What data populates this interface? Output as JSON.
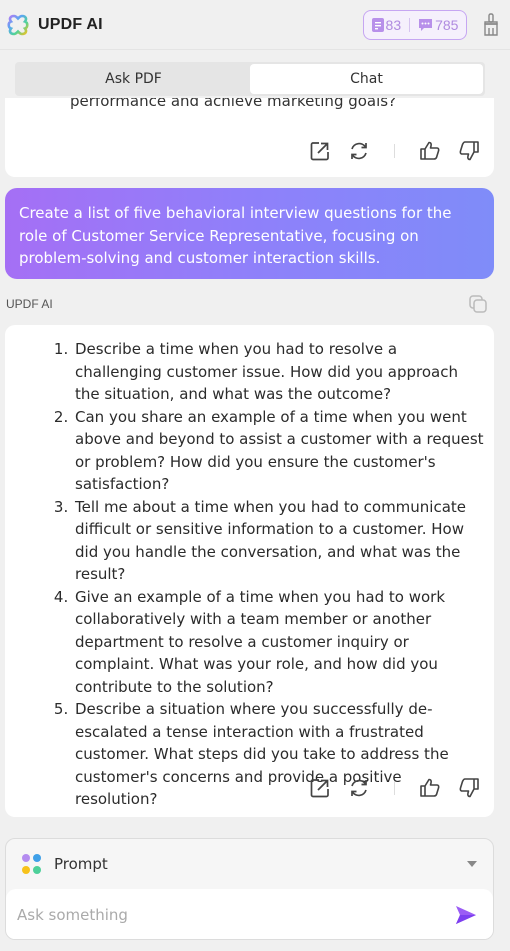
{
  "header": {
    "app_title": "UPDF AI",
    "doc_quota": "83",
    "chat_quota": "785"
  },
  "tabs": [
    {
      "label": "Ask PDF",
      "active": false
    },
    {
      "label": "Chat",
      "active": true
    }
  ],
  "previous_answer": {
    "tail_text": "performance and achieve marketing goals?"
  },
  "user_message": "Create a list of five behavioral interview questions for the role of Customer Service Representative, focusing on problem-solving and customer interaction skills.",
  "ai_label": "UPDF AI",
  "answer": {
    "items": [
      "Describe a time when you had to resolve a challenging customer issue. How did you approach the situation, and what was the outcome?",
      "Can you share an example of a time when you went above and beyond to assist a customer with a request or problem? How did you ensure the customer's satisfaction?",
      "Tell me about a time when you had to communicate difficult or sensitive information to a customer. How did you handle the conversation, and what was the result?",
      "Give an example of a time when you had to work collaboratively with a team member or another department to resolve a customer inquiry or complaint. What was your role, and how did you contribute to the solution?",
      "Describe a situation where you successfully de-escalated a tense interaction with a frustrated customer. What steps did you take to address the customer's concerns and provide a positive resolution?"
    ]
  },
  "icons": {
    "export": "export-icon",
    "regenerate": "regenerate-icon",
    "like": "thumbs-up-icon",
    "dislike": "thumbs-down-icon",
    "copy": "copy-icon",
    "clean": "broom-icon",
    "send": "send-icon"
  },
  "composer": {
    "prompt_label": "Prompt",
    "input_placeholder": "Ask something",
    "input_value": ""
  },
  "colors": {
    "accent": "#9b6cf5",
    "bubble_start": "#a56ff5",
    "bubble_end": "#7f8cf9",
    "dot_purple": "#b48cf0",
    "dot_blue": "#3fa0e8",
    "dot_yellow": "#f7c21b",
    "dot_green": "#4dd09a"
  }
}
